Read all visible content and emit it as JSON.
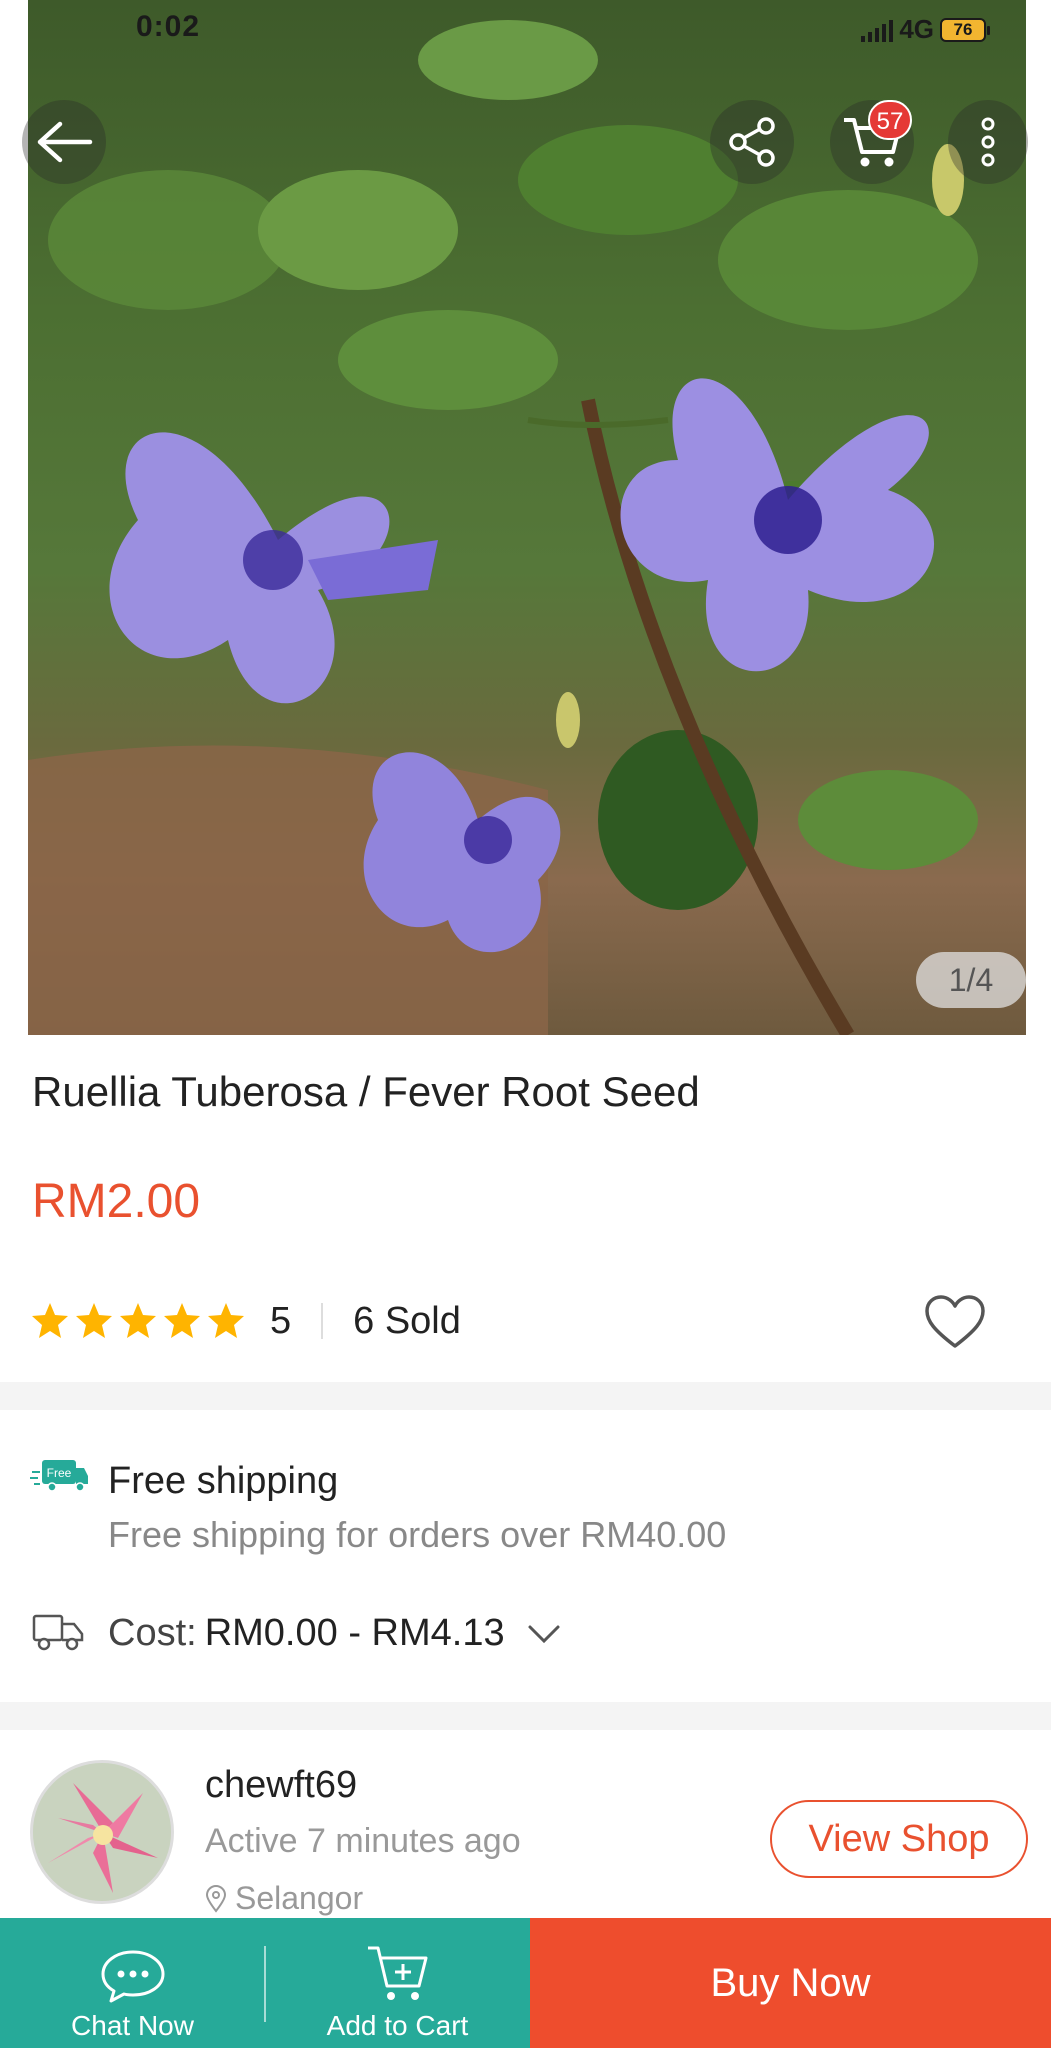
{
  "status_bar": {
    "time": "0:02",
    "network": "4G",
    "battery": "76"
  },
  "top_actions": {
    "back_icon": "arrow-left-icon",
    "share_icon": "share-icon",
    "cart_icon": "cart-icon",
    "cart_count": "57",
    "more_icon": "more-vertical-icon"
  },
  "gallery": {
    "counter": "1/4"
  },
  "product": {
    "title": "Ruellia Tuberosa / Fever Root Seed",
    "price": "RM2.00",
    "rating": "5",
    "rating_stars": 5,
    "sold": "6 Sold"
  },
  "shipping": {
    "badge": "Free",
    "title": "Free shipping",
    "subtitle": "Free shipping for orders over RM40.00",
    "cost_label": "Cost:",
    "cost_value": "RM0.00 - RM4.13"
  },
  "shop": {
    "name": "chewft69",
    "active": "Active 7 minutes ago",
    "location": "Selangor",
    "view_button": "View Shop"
  },
  "bottom_bar": {
    "chat_label": "Chat Now",
    "cart_label": "Add to Cart",
    "buy_label": "Buy Now"
  },
  "colors": {
    "accent_orange": "#ee4d2d",
    "price_red": "#e9512f",
    "teal": "#26aa99",
    "star_yellow": "#ffb400"
  }
}
